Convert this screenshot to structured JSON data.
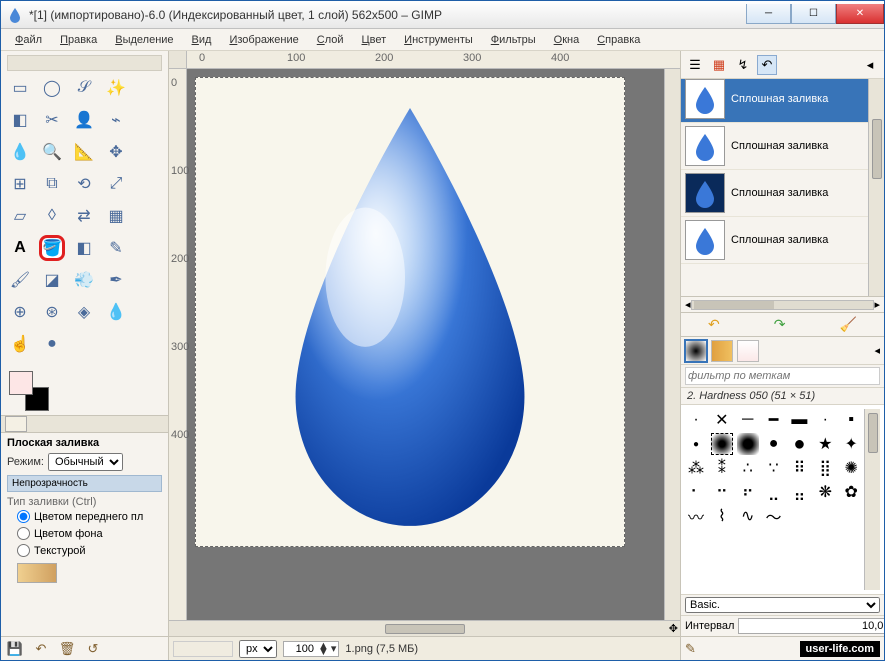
{
  "window": {
    "title": "*[1] (импортировано)-6.0 (Индексированный цвет, 1 слой) 562x500 – GIMP"
  },
  "menu": [
    "Файл",
    "Правка",
    "Выделение",
    "Вид",
    "Изображение",
    "Слой",
    "Цвет",
    "Инструменты",
    "Фильтры",
    "Окна",
    "Справка"
  ],
  "tool_highlight": "bucket-fill",
  "tool_options": {
    "title": "Плоская заливка",
    "mode_label": "Режим:",
    "mode_value": "Обычный",
    "opacity_label": "Непрозрачность",
    "fill_type_label": "Тип заливки (Ctrl)",
    "fill_fg": "Цветом переднего пл",
    "fill_bg": "Цветом фона",
    "fill_pattern": "Текстурой"
  },
  "ruler_marks_h": [
    "0",
    "100",
    "200",
    "300",
    "400"
  ],
  "ruler_marks_v": [
    "0",
    "100",
    "200",
    "300",
    "400"
  ],
  "status": {
    "unit": "px",
    "zoom": "100",
    "filename": "1.png (7,5 МБ)"
  },
  "history": {
    "items": [
      {
        "label": "Сплошная заливка",
        "bg": "light",
        "selected": true,
        "cut": true
      },
      {
        "label": "Сплошная заливка",
        "bg": "light",
        "selected": false
      },
      {
        "label": "Сплошная заливка",
        "bg": "dark",
        "selected": false
      },
      {
        "label": "Сплошная заливка",
        "bg": "light",
        "selected": false
      }
    ]
  },
  "brush": {
    "filter_placeholder": "фильтр по меткам",
    "info": "2. Hardness 050 (51 × 51)",
    "preset": "Basic.",
    "interval_label": "Интервал",
    "interval_value": "10,0"
  },
  "watermark": "user-life.com"
}
